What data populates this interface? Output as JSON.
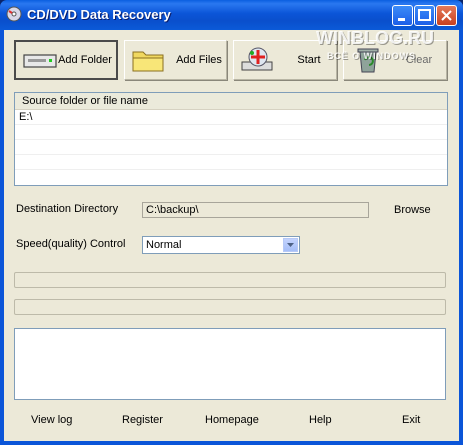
{
  "window": {
    "title": "CD/DVD Data Recovery"
  },
  "toolbar": {
    "add_folder": "Add Folder",
    "add_files": "Add Files",
    "start": "Start",
    "clear": "Clear"
  },
  "source_list": {
    "column_header": "Source folder or file name",
    "rows": [
      "E:\\",
      "",
      "",
      "",
      ""
    ]
  },
  "destination": {
    "label": "Destination Directory",
    "value": "C:\\backup\\",
    "browse": "Browse"
  },
  "speed": {
    "label": "Speed(quality) Control",
    "selected": "Normal"
  },
  "footer": {
    "view_log": "View log",
    "register": "Register",
    "homepage": "Homepage",
    "help": "Help",
    "exit": "Exit"
  },
  "watermark": {
    "line1": "WINBLOG.RU",
    "line2": "ВСЁ О WINDOWS"
  },
  "colors": {
    "titlebar": "#0b55d8",
    "dialog": "#ece9d8",
    "list_border": "#7f9db9"
  }
}
